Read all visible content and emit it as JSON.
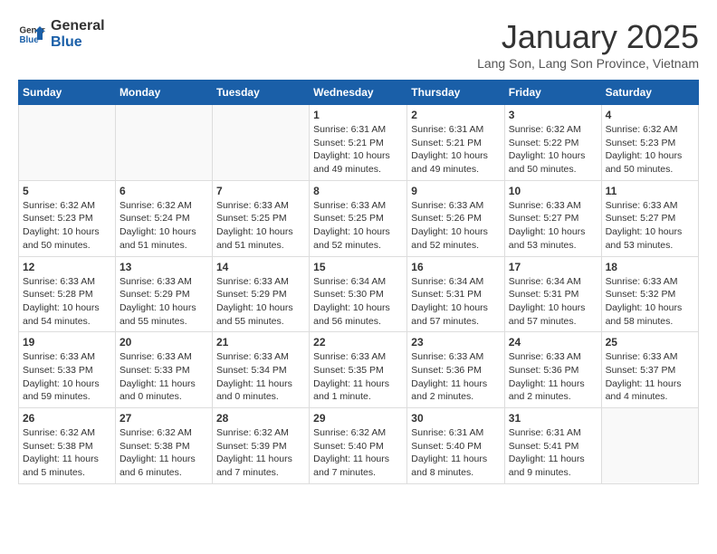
{
  "logo": {
    "line1": "General",
    "line2": "Blue"
  },
  "title": "January 2025",
  "location": "Lang Son, Lang Son Province, Vietnam",
  "days_of_week": [
    "Sunday",
    "Monday",
    "Tuesday",
    "Wednesday",
    "Thursday",
    "Friday",
    "Saturday"
  ],
  "weeks": [
    [
      {
        "day": "",
        "info": ""
      },
      {
        "day": "",
        "info": ""
      },
      {
        "day": "",
        "info": ""
      },
      {
        "day": "1",
        "info": "Sunrise: 6:31 AM\nSunset: 5:21 PM\nDaylight: 10 hours\nand 49 minutes."
      },
      {
        "day": "2",
        "info": "Sunrise: 6:31 AM\nSunset: 5:21 PM\nDaylight: 10 hours\nand 49 minutes."
      },
      {
        "day": "3",
        "info": "Sunrise: 6:32 AM\nSunset: 5:22 PM\nDaylight: 10 hours\nand 50 minutes."
      },
      {
        "day": "4",
        "info": "Sunrise: 6:32 AM\nSunset: 5:23 PM\nDaylight: 10 hours\nand 50 minutes."
      }
    ],
    [
      {
        "day": "5",
        "info": "Sunrise: 6:32 AM\nSunset: 5:23 PM\nDaylight: 10 hours\nand 50 minutes."
      },
      {
        "day": "6",
        "info": "Sunrise: 6:32 AM\nSunset: 5:24 PM\nDaylight: 10 hours\nand 51 minutes."
      },
      {
        "day": "7",
        "info": "Sunrise: 6:33 AM\nSunset: 5:25 PM\nDaylight: 10 hours\nand 51 minutes."
      },
      {
        "day": "8",
        "info": "Sunrise: 6:33 AM\nSunset: 5:25 PM\nDaylight: 10 hours\nand 52 minutes."
      },
      {
        "day": "9",
        "info": "Sunrise: 6:33 AM\nSunset: 5:26 PM\nDaylight: 10 hours\nand 52 minutes."
      },
      {
        "day": "10",
        "info": "Sunrise: 6:33 AM\nSunset: 5:27 PM\nDaylight: 10 hours\nand 53 minutes."
      },
      {
        "day": "11",
        "info": "Sunrise: 6:33 AM\nSunset: 5:27 PM\nDaylight: 10 hours\nand 53 minutes."
      }
    ],
    [
      {
        "day": "12",
        "info": "Sunrise: 6:33 AM\nSunset: 5:28 PM\nDaylight: 10 hours\nand 54 minutes."
      },
      {
        "day": "13",
        "info": "Sunrise: 6:33 AM\nSunset: 5:29 PM\nDaylight: 10 hours\nand 55 minutes."
      },
      {
        "day": "14",
        "info": "Sunrise: 6:33 AM\nSunset: 5:29 PM\nDaylight: 10 hours\nand 55 minutes."
      },
      {
        "day": "15",
        "info": "Sunrise: 6:34 AM\nSunset: 5:30 PM\nDaylight: 10 hours\nand 56 minutes."
      },
      {
        "day": "16",
        "info": "Sunrise: 6:34 AM\nSunset: 5:31 PM\nDaylight: 10 hours\nand 57 minutes."
      },
      {
        "day": "17",
        "info": "Sunrise: 6:34 AM\nSunset: 5:31 PM\nDaylight: 10 hours\nand 57 minutes."
      },
      {
        "day": "18",
        "info": "Sunrise: 6:33 AM\nSunset: 5:32 PM\nDaylight: 10 hours\nand 58 minutes."
      }
    ],
    [
      {
        "day": "19",
        "info": "Sunrise: 6:33 AM\nSunset: 5:33 PM\nDaylight: 10 hours\nand 59 minutes."
      },
      {
        "day": "20",
        "info": "Sunrise: 6:33 AM\nSunset: 5:33 PM\nDaylight: 11 hours\nand 0 minutes."
      },
      {
        "day": "21",
        "info": "Sunrise: 6:33 AM\nSunset: 5:34 PM\nDaylight: 11 hours\nand 0 minutes."
      },
      {
        "day": "22",
        "info": "Sunrise: 6:33 AM\nSunset: 5:35 PM\nDaylight: 11 hours\nand 1 minute."
      },
      {
        "day": "23",
        "info": "Sunrise: 6:33 AM\nSunset: 5:36 PM\nDaylight: 11 hours\nand 2 minutes."
      },
      {
        "day": "24",
        "info": "Sunrise: 6:33 AM\nSunset: 5:36 PM\nDaylight: 11 hours\nand 2 minutes."
      },
      {
        "day": "25",
        "info": "Sunrise: 6:33 AM\nSunset: 5:37 PM\nDaylight: 11 hours\nand 4 minutes."
      }
    ],
    [
      {
        "day": "26",
        "info": "Sunrise: 6:32 AM\nSunset: 5:38 PM\nDaylight: 11 hours\nand 5 minutes."
      },
      {
        "day": "27",
        "info": "Sunrise: 6:32 AM\nSunset: 5:38 PM\nDaylight: 11 hours\nand 6 minutes."
      },
      {
        "day": "28",
        "info": "Sunrise: 6:32 AM\nSunset: 5:39 PM\nDaylight: 11 hours\nand 7 minutes."
      },
      {
        "day": "29",
        "info": "Sunrise: 6:32 AM\nSunset: 5:40 PM\nDaylight: 11 hours\nand 7 minutes."
      },
      {
        "day": "30",
        "info": "Sunrise: 6:31 AM\nSunset: 5:40 PM\nDaylight: 11 hours\nand 8 minutes."
      },
      {
        "day": "31",
        "info": "Sunrise: 6:31 AM\nSunset: 5:41 PM\nDaylight: 11 hours\nand 9 minutes."
      },
      {
        "day": "",
        "info": ""
      }
    ]
  ]
}
